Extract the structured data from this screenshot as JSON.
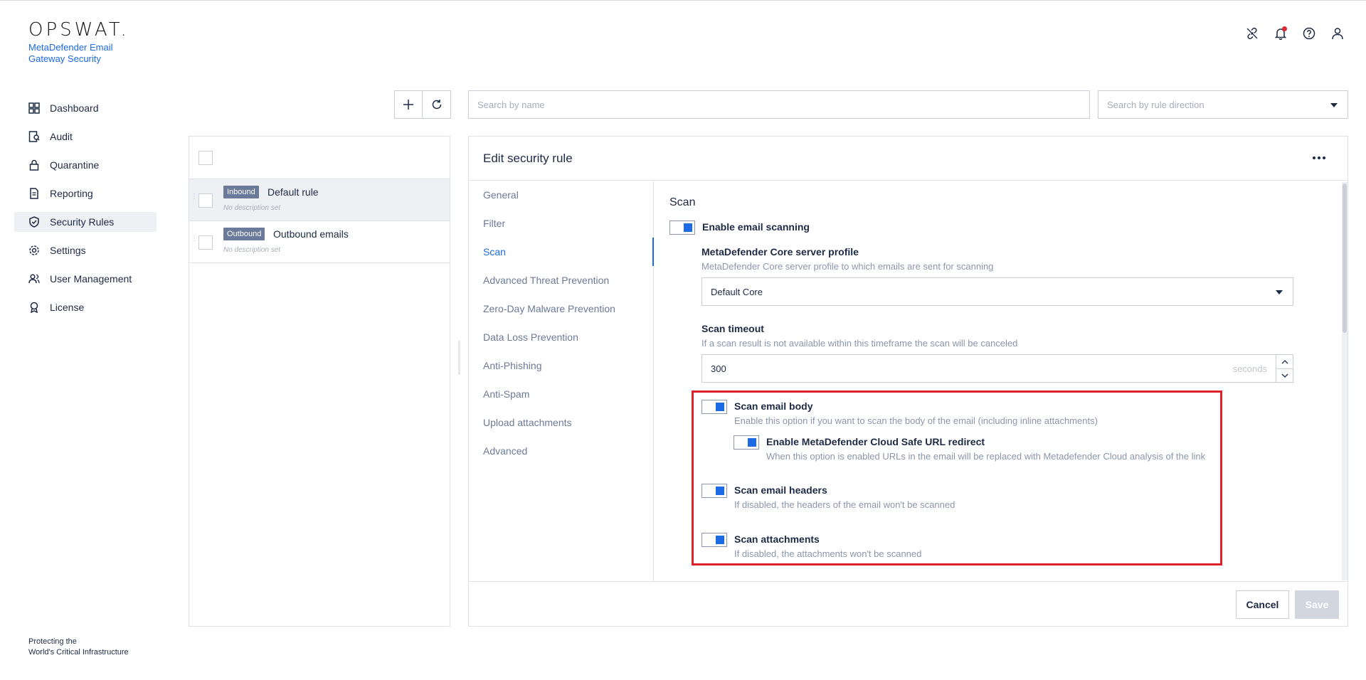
{
  "app": {
    "logo": "OPSWAT.",
    "product_name": "MetaDefender Email Gateway Security",
    "footer_line1": "Protecting the",
    "footer_line2": "World's Critical Infrastructure"
  },
  "sidebar": {
    "items": [
      {
        "label": "Dashboard",
        "icon": "dashboard-icon"
      },
      {
        "label": "Audit",
        "icon": "audit-icon"
      },
      {
        "label": "Quarantine",
        "icon": "lock-icon"
      },
      {
        "label": "Reporting",
        "icon": "document-icon"
      },
      {
        "label": "Security Rules",
        "icon": "shield-check-icon",
        "active": true
      },
      {
        "label": "Settings",
        "icon": "gear-icon"
      },
      {
        "label": "User Management",
        "icon": "users-icon"
      },
      {
        "label": "License",
        "icon": "award-icon"
      }
    ]
  },
  "header_icons": [
    "link-icon",
    "bell-icon",
    "help-icon",
    "user-icon"
  ],
  "toolbar": {
    "search_placeholder": "Search by name",
    "direction_placeholder": "Search by rule direction"
  },
  "rules": [
    {
      "direction": "Inbound",
      "name": "Default rule",
      "description": "No description set",
      "selected": true
    },
    {
      "direction": "Outbound",
      "name": "Outbound emails",
      "description": "No description set",
      "selected": false
    }
  ],
  "edit": {
    "title": "Edit security rule",
    "tabs": [
      "General",
      "Filter",
      "Scan",
      "Advanced Threat Prevention",
      "Zero-Day Malware Prevention",
      "Data Loss Prevention",
      "Anti-Phishing",
      "Anti-Spam",
      "Upload attachments",
      "Advanced"
    ],
    "active_tab": "Scan",
    "scan": {
      "section_title": "Scan",
      "enable_label": "Enable email scanning",
      "server_profile_label": "MetaDefender Core server profile",
      "server_profile_desc": "MetaDefender Core server profile to which emails are sent for scanning",
      "server_profile_value": "Default Core",
      "timeout_label": "Scan timeout",
      "timeout_desc": "If a scan result is not available within this timeframe the scan will be canceled",
      "timeout_value": "300",
      "timeout_unit": "seconds",
      "body_label": "Scan email body",
      "body_desc": "Enable this option if you want to scan the body of the email (including inline attachments)",
      "cloud_label": "Enable MetaDefender Cloud Safe URL redirect",
      "cloud_desc": "When this option is enabled URLs in the email will be replaced with Metadefender Cloud analysis of the link",
      "headers_label": "Scan email headers",
      "headers_desc": "If disabled, the headers of the email won't be scanned",
      "attachments_label": "Scan attachments",
      "attachments_desc": "If disabled, the attachments won't be scanned"
    },
    "cancel_label": "Cancel",
    "save_label": "Save"
  },
  "colors": {
    "accent": "#1d6ae5",
    "highlight": "#e0202b",
    "badge": "#6b7a98"
  }
}
